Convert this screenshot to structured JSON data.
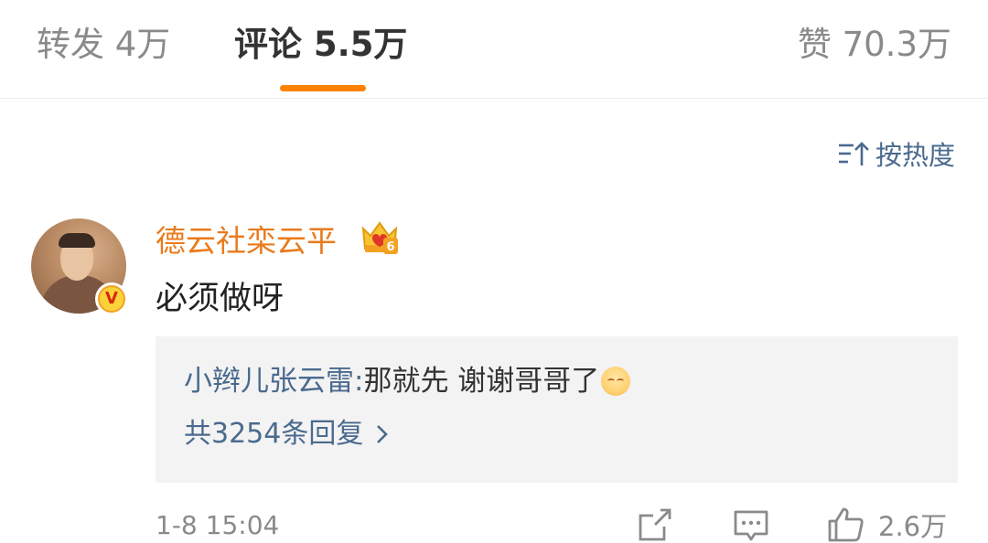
{
  "tabs": {
    "repost": "转发 4万",
    "comment": "评论 5.5万",
    "like": "赞 70.3万",
    "accent_color": "#ff8200"
  },
  "sort": {
    "label": "按热度",
    "icon": "sort-icon"
  },
  "comment": {
    "username": "德云社栾云平",
    "text": "必须做呀",
    "verified_badge": "V",
    "membership_icon": "crown-icon",
    "membership_level": "6",
    "time": "1-8 15:04",
    "like_count": "2.6万",
    "reply": {
      "user": "小辫儿张云雷",
      "separator": ": ",
      "text": "那就先 谢谢哥哥了",
      "emoji": "shy-smile-emoji"
    },
    "reply_count_label": "共3254条回复"
  },
  "colors": {
    "username": "#ea7a1b",
    "link": "#4a6a8e",
    "muted": "#8a8a8a"
  }
}
